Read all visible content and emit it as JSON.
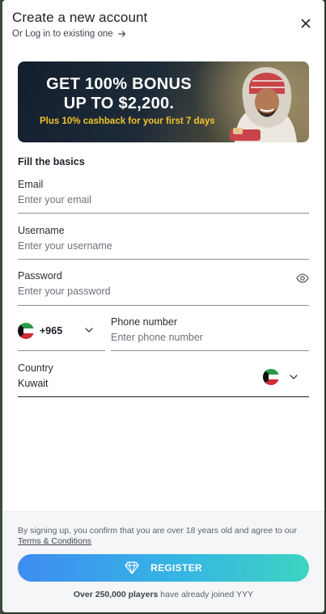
{
  "header": {
    "title": "Create a new account",
    "login_link": "Or Log in to existing one"
  },
  "banner": {
    "line1": "GET 100% BONUS",
    "line2": "UP TO $2,200.",
    "subline": "Plus 10% cashback for your first 7 days"
  },
  "form": {
    "section_title": "Fill the basics",
    "email": {
      "label": "Email",
      "placeholder": "Enter your email"
    },
    "username": {
      "label": "Username",
      "placeholder": "Enter your username"
    },
    "password": {
      "label": "Password",
      "placeholder": "Enter your password"
    },
    "phone_code": "+965",
    "phone": {
      "label": "Phone number",
      "placeholder": "Enter phone number"
    },
    "country": {
      "label": "Country",
      "value": "Kuwait"
    }
  },
  "footer": {
    "terms_prefix": "By signing up, you confirm that you are over 18 years old and agree to our",
    "terms_link": "Terms & Conditions",
    "register_label": "REGISTER",
    "players_bold": "Over 250,000 players",
    "players_rest": "have already joined YYY"
  },
  "colors": {
    "accent_start": "#3f8cf2",
    "accent_end": "#3ed3c2",
    "bonus_yellow": "#f3c22c",
    "banner_dark": "#141f2e"
  },
  "icons": [
    "arrow-right-icon",
    "close-icon",
    "eye-icon",
    "kuwait-flag-icon",
    "chevron-down-icon",
    "diamond-icon"
  ]
}
